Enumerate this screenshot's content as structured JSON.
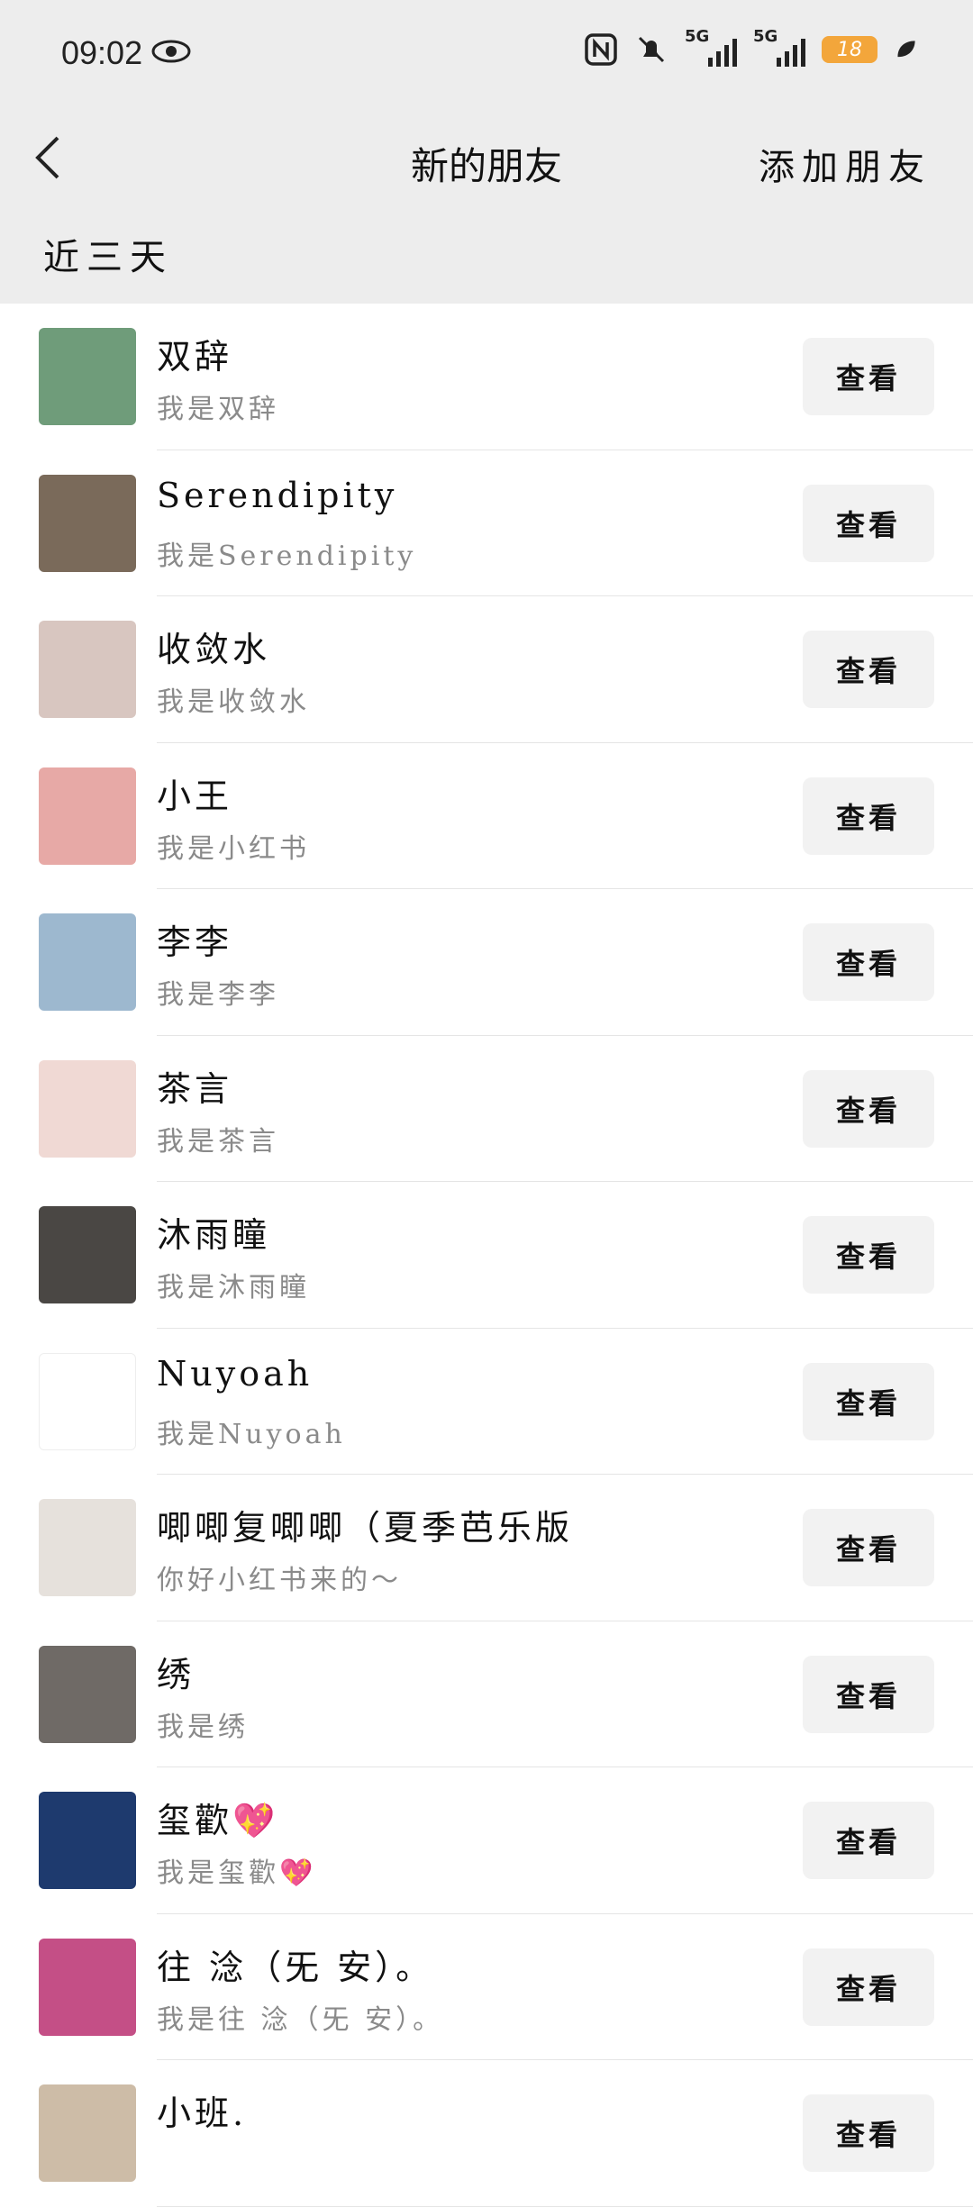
{
  "status_bar": {
    "time": "09:02",
    "signal1_label": "5G",
    "signal2_label": "5G",
    "battery": "18",
    "battery_color": "#f3a63b"
  },
  "nav": {
    "title": "新的朋友",
    "add_label": "添加朋友"
  },
  "section_title": "近三天",
  "view_label": "查看",
  "rows": [
    {
      "name": "双辞",
      "msg": "我是双辞",
      "avatar_color": "#6f9c7a"
    },
    {
      "name": "Serendipity",
      "msg": "我是Serendipity",
      "avatar_color": "#7a6a5a"
    },
    {
      "name": "收敛水",
      "msg": "我是收敛水",
      "avatar_color": "#d8c6c0"
    },
    {
      "name": "小王",
      "msg": "我是小红书",
      "avatar_color": "#e7a9a6"
    },
    {
      "name": "李李",
      "msg": "我是李李",
      "avatar_color": "#9db8cf"
    },
    {
      "name": "茶言",
      "msg": "我是茶言",
      "avatar_color": "#f0d9d4"
    },
    {
      "name": "沐雨瞳",
      "msg": "我是沐雨瞳",
      "avatar_color": "#4a4744"
    },
    {
      "name": "Nuyoah",
      "msg": "我是Nuyoah",
      "avatar_color": "#ffffff"
    },
    {
      "name": "唧唧复唧唧（夏季芭乐版",
      "msg": "你好小红书来的～",
      "avatar_color": "#e6e1dc"
    },
    {
      "name": "绣",
      "msg": "我是绣",
      "avatar_color": "#6f6a66"
    },
    {
      "name": "玺歡💖",
      "msg": "我是玺歡💖",
      "avatar_color": "#1e3a6e"
    },
    {
      "name": "往 淰（旡 安）。",
      "msg": "我是往 淰（旡 安）。",
      "avatar_color": "#c44f86"
    },
    {
      "name": "小班.",
      "msg": "",
      "avatar_color": "#cdbca7"
    }
  ]
}
